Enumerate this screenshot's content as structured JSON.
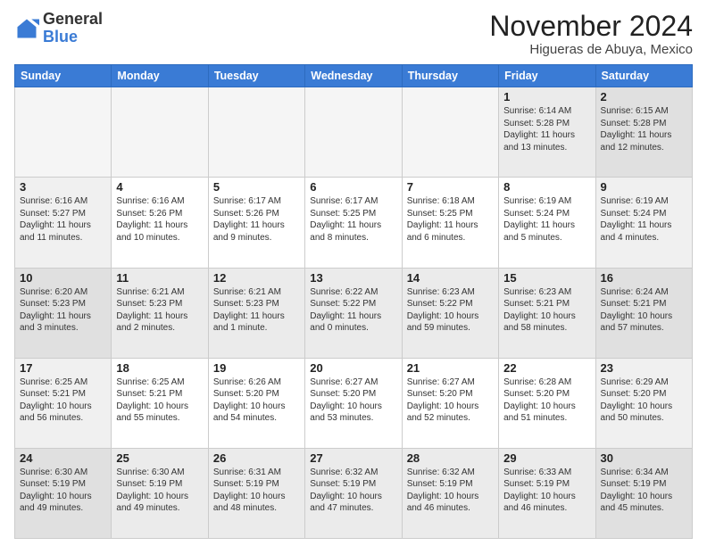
{
  "logo": {
    "general": "General",
    "blue": "Blue"
  },
  "header": {
    "month": "November 2024",
    "location": "Higueras de Abuya, Mexico"
  },
  "weekdays": [
    "Sunday",
    "Monday",
    "Tuesday",
    "Wednesday",
    "Thursday",
    "Friday",
    "Saturday"
  ],
  "weeks": [
    [
      {
        "day": "",
        "info": ""
      },
      {
        "day": "",
        "info": ""
      },
      {
        "day": "",
        "info": ""
      },
      {
        "day": "",
        "info": ""
      },
      {
        "day": "",
        "info": ""
      },
      {
        "day": "1",
        "info": "Sunrise: 6:14 AM\nSunset: 5:28 PM\nDaylight: 11 hours\nand 13 minutes."
      },
      {
        "day": "2",
        "info": "Sunrise: 6:15 AM\nSunset: 5:28 PM\nDaylight: 11 hours\nand 12 minutes."
      }
    ],
    [
      {
        "day": "3",
        "info": "Sunrise: 6:16 AM\nSunset: 5:27 PM\nDaylight: 11 hours\nand 11 minutes."
      },
      {
        "day": "4",
        "info": "Sunrise: 6:16 AM\nSunset: 5:26 PM\nDaylight: 11 hours\nand 10 minutes."
      },
      {
        "day": "5",
        "info": "Sunrise: 6:17 AM\nSunset: 5:26 PM\nDaylight: 11 hours\nand 9 minutes."
      },
      {
        "day": "6",
        "info": "Sunrise: 6:17 AM\nSunset: 5:25 PM\nDaylight: 11 hours\nand 8 minutes."
      },
      {
        "day": "7",
        "info": "Sunrise: 6:18 AM\nSunset: 5:25 PM\nDaylight: 11 hours\nand 6 minutes."
      },
      {
        "day": "8",
        "info": "Sunrise: 6:19 AM\nSunset: 5:24 PM\nDaylight: 11 hours\nand 5 minutes."
      },
      {
        "day": "9",
        "info": "Sunrise: 6:19 AM\nSunset: 5:24 PM\nDaylight: 11 hours\nand 4 minutes."
      }
    ],
    [
      {
        "day": "10",
        "info": "Sunrise: 6:20 AM\nSunset: 5:23 PM\nDaylight: 11 hours\nand 3 minutes."
      },
      {
        "day": "11",
        "info": "Sunrise: 6:21 AM\nSunset: 5:23 PM\nDaylight: 11 hours\nand 2 minutes."
      },
      {
        "day": "12",
        "info": "Sunrise: 6:21 AM\nSunset: 5:23 PM\nDaylight: 11 hours\nand 1 minute."
      },
      {
        "day": "13",
        "info": "Sunrise: 6:22 AM\nSunset: 5:22 PM\nDaylight: 11 hours\nand 0 minutes."
      },
      {
        "day": "14",
        "info": "Sunrise: 6:23 AM\nSunset: 5:22 PM\nDaylight: 10 hours\nand 59 minutes."
      },
      {
        "day": "15",
        "info": "Sunrise: 6:23 AM\nSunset: 5:21 PM\nDaylight: 10 hours\nand 58 minutes."
      },
      {
        "day": "16",
        "info": "Sunrise: 6:24 AM\nSunset: 5:21 PM\nDaylight: 10 hours\nand 57 minutes."
      }
    ],
    [
      {
        "day": "17",
        "info": "Sunrise: 6:25 AM\nSunset: 5:21 PM\nDaylight: 10 hours\nand 56 minutes."
      },
      {
        "day": "18",
        "info": "Sunrise: 6:25 AM\nSunset: 5:21 PM\nDaylight: 10 hours\nand 55 minutes."
      },
      {
        "day": "19",
        "info": "Sunrise: 6:26 AM\nSunset: 5:20 PM\nDaylight: 10 hours\nand 54 minutes."
      },
      {
        "day": "20",
        "info": "Sunrise: 6:27 AM\nSunset: 5:20 PM\nDaylight: 10 hours\nand 53 minutes."
      },
      {
        "day": "21",
        "info": "Sunrise: 6:27 AM\nSunset: 5:20 PM\nDaylight: 10 hours\nand 52 minutes."
      },
      {
        "day": "22",
        "info": "Sunrise: 6:28 AM\nSunset: 5:20 PM\nDaylight: 10 hours\nand 51 minutes."
      },
      {
        "day": "23",
        "info": "Sunrise: 6:29 AM\nSunset: 5:20 PM\nDaylight: 10 hours\nand 50 minutes."
      }
    ],
    [
      {
        "day": "24",
        "info": "Sunrise: 6:30 AM\nSunset: 5:19 PM\nDaylight: 10 hours\nand 49 minutes."
      },
      {
        "day": "25",
        "info": "Sunrise: 6:30 AM\nSunset: 5:19 PM\nDaylight: 10 hours\nand 49 minutes."
      },
      {
        "day": "26",
        "info": "Sunrise: 6:31 AM\nSunset: 5:19 PM\nDaylight: 10 hours\nand 48 minutes."
      },
      {
        "day": "27",
        "info": "Sunrise: 6:32 AM\nSunset: 5:19 PM\nDaylight: 10 hours\nand 47 minutes."
      },
      {
        "day": "28",
        "info": "Sunrise: 6:32 AM\nSunset: 5:19 PM\nDaylight: 10 hours\nand 46 minutes."
      },
      {
        "day": "29",
        "info": "Sunrise: 6:33 AM\nSunset: 5:19 PM\nDaylight: 10 hours\nand 46 minutes."
      },
      {
        "day": "30",
        "info": "Sunrise: 6:34 AM\nSunset: 5:19 PM\nDaylight: 10 hours\nand 45 minutes."
      }
    ]
  ]
}
